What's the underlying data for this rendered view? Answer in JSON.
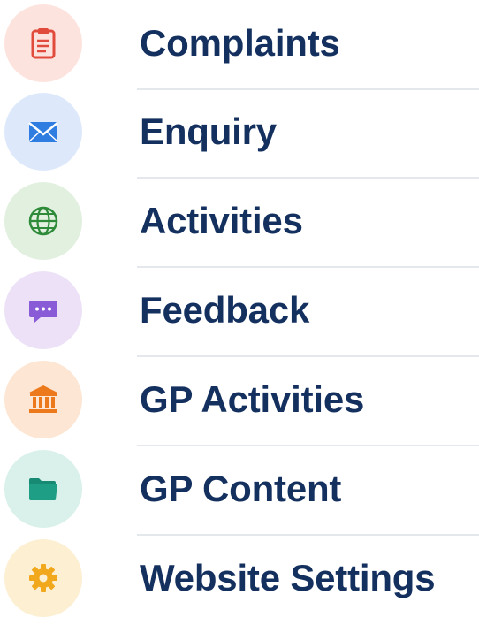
{
  "menu": {
    "items": [
      {
        "label": "Complaints",
        "icon": "clipboard-icon",
        "bg": "#fde3de",
        "color": "#e14b3b"
      },
      {
        "label": "Enquiry",
        "icon": "envelope-icon",
        "bg": "#dde9fb",
        "color": "#2f7de1"
      },
      {
        "label": "Activities",
        "icon": "globe-icon",
        "bg": "#e1f0df",
        "color": "#2e8b3a"
      },
      {
        "label": "Feedback",
        "icon": "chat-bubble-icon",
        "bg": "#ece1f6",
        "color": "#8a5bd6"
      },
      {
        "label": "GP Activities",
        "icon": "building-pillars-icon",
        "bg": "#fde6d3",
        "color": "#ec7a1c"
      },
      {
        "label": "GP Content",
        "icon": "folder-icon",
        "bg": "#d9f1ea",
        "color": "#1f9e86"
      },
      {
        "label": "Website Settings",
        "icon": "gear-icon",
        "bg": "#fdefd2",
        "color": "#f2a81c"
      }
    ]
  }
}
